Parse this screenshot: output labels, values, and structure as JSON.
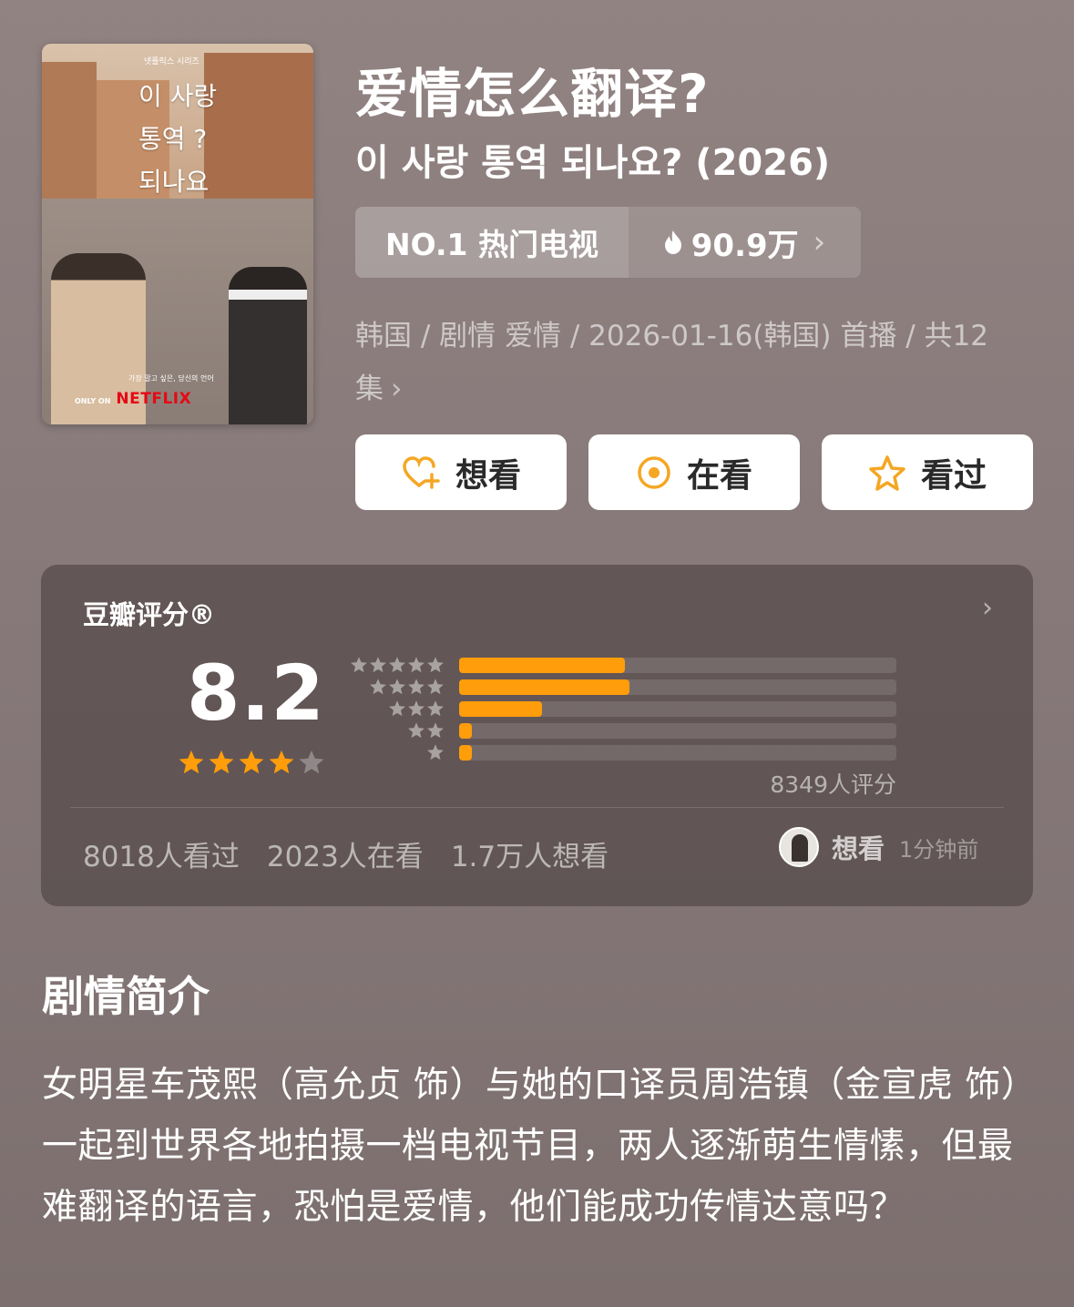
{
  "poster": {
    "top_small": "넷플릭스 시리즈",
    "title_lines": "이 사랑\n통역 ?\n되나요",
    "tagline": "가장 말고 싶은, 당신의 언어",
    "only_on": "ONLY ON",
    "netflix": "NETFLIX"
  },
  "header": {
    "title": "爱情怎么翻译?",
    "subtitle": "이 사랑 통역 되나요? (2026)"
  },
  "rank": {
    "label": "NO.1 热门电视",
    "hot": "90.9万",
    "flame_icon": "flame-icon"
  },
  "meta": {
    "text": "韩国 / 剧情 爱情 / 2026-01-16(韩国) 首播 / 共12集"
  },
  "actions": {
    "want": "想看",
    "watching": "在看",
    "watched": "看过",
    "accent": "#f5a623"
  },
  "rating": {
    "title": "豆瓣评分®",
    "score": "8.2",
    "stars": 4,
    "distribution": [
      {
        "stars": 5,
        "fraction": 0.38
      },
      {
        "stars": 4,
        "fraction": 0.39
      },
      {
        "stars": 3,
        "fraction": 0.19
      },
      {
        "stars": 2,
        "fraction": 0.03
      },
      {
        "stars": 1,
        "fraction": 0.03
      }
    ],
    "count_text": "8349人评分",
    "bar_color": "#ff9d0a",
    "stats": [
      "8018人看过",
      "2023人在看",
      "1.7万人想看"
    ],
    "recent_action": "想看",
    "recent_time": "1分钟前"
  },
  "synopsis": {
    "title": "剧情简介",
    "text": "女明星车茂熙（高允贞 饰）与她的口译员周浩镇（金宣虎 饰）一起到世界各地拍摄一档电视节目，两人逐渐萌生情愫，但最难翻译的语言，恐怕是爱情，他们能成功传情达意吗？"
  }
}
